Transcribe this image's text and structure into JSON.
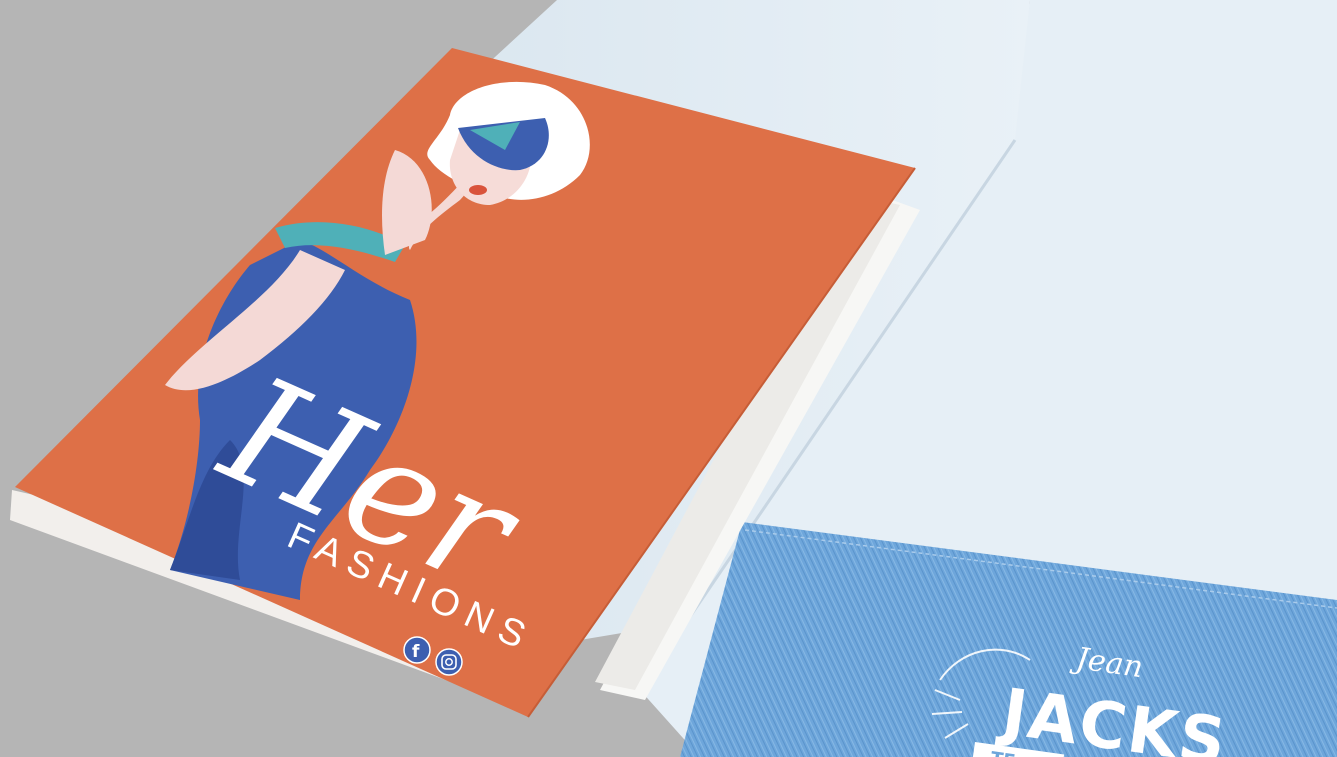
{
  "scene": {
    "description_colors": {
      "background": "#b5b5b5",
      "folder_inner": "#e6eff6",
      "folder_inner_shade": "#d3e0ea",
      "cover_orange": "#de7047",
      "denim": "#6ea6db",
      "dress_blue": "#3d5fb0",
      "skin": "#f4d9d6",
      "hair": "#ffffff",
      "visor_teal": "#4fb0b8"
    }
  },
  "cover": {
    "brand_script": "Her",
    "brand_caps": "FASHIONS",
    "social_icons": [
      "facebook-icon",
      "instagram-icon"
    ],
    "facebook_glyph": "f"
  },
  "pocket": {
    "script_top": "Jean",
    "big_letters": "JACKS",
    "banner_text": "TE"
  }
}
